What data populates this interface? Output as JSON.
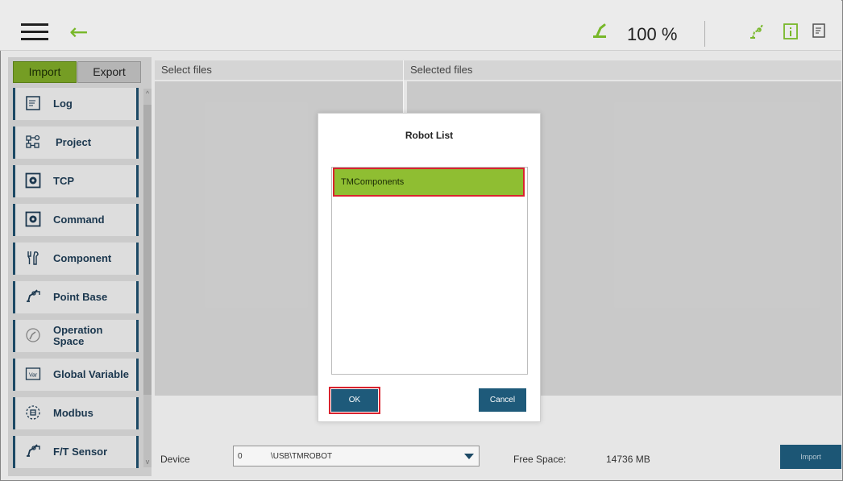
{
  "topbar": {
    "speed": "100 %",
    "icons": [
      "menu-icon",
      "back-arrow-icon",
      "robot-status-icon",
      "robot-arm-icon",
      "info-icon",
      "document-icon"
    ],
    "accent": "#7cbf2a"
  },
  "tabs": {
    "import": "Import",
    "export": "Export"
  },
  "sidebar": {
    "items": [
      {
        "label": "Log",
        "icon": "log-icon"
      },
      {
        "label": "Project",
        "icon": "project-icon"
      },
      {
        "label": "TCP",
        "icon": "tcp-icon"
      },
      {
        "label": "Command",
        "icon": "command-icon"
      },
      {
        "label": "Component",
        "icon": "component-icon"
      },
      {
        "label": "Point Base",
        "icon": "point-base-icon"
      },
      {
        "label": "Operation Space",
        "icon": "operation-space-icon"
      },
      {
        "label": "Global Variable",
        "icon": "global-variable-icon"
      },
      {
        "label": "Modbus",
        "icon": "modbus-icon"
      },
      {
        "label": "F/T Sensor",
        "icon": "ft-sensor-icon"
      }
    ]
  },
  "columns": {
    "select": "Select files",
    "selected": "Selected files"
  },
  "bottom": {
    "device_label": "Device",
    "device_num": "0",
    "device_path": "\\USB\\TMROBOT",
    "free_label": "Free Space:",
    "free_value": "14736 MB",
    "import_button": "Import"
  },
  "modal": {
    "title": "Robot List",
    "items": [
      "TMComponents"
    ],
    "ok": "OK",
    "cancel": "Cancel"
  },
  "colors": {
    "highlight": "#d9232e",
    "primary_button": "#1e5a7a",
    "selected_item": "#8fbe32"
  }
}
